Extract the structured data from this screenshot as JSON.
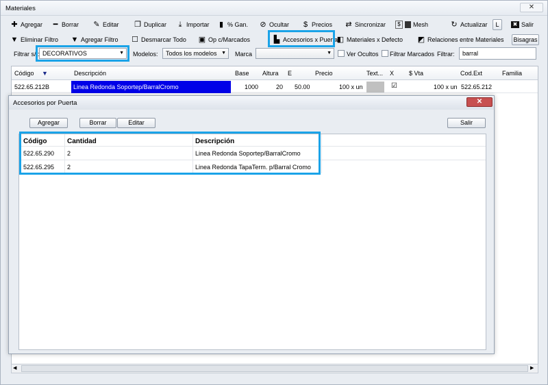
{
  "window": {
    "title": "Materiales",
    "close_label": "✕"
  },
  "toolbar": {
    "row1": [
      {
        "icon": "plus-icon",
        "glyph": "✚",
        "label": "Agregar"
      },
      {
        "icon": "minus-icon",
        "glyph": "━",
        "label": "Borrar"
      },
      {
        "icon": "edit-icon",
        "glyph": "✎",
        "label": "Editar"
      },
      {
        "icon": "duplicate-icon",
        "glyph": "❐",
        "label": "Duplicar"
      },
      {
        "icon": "import-icon",
        "glyph": "⤓",
        "label": "Importar"
      },
      {
        "icon": "bar-chart-icon",
        "glyph": "▮",
        "label": "% Gan."
      },
      {
        "icon": "hide-icon",
        "glyph": "⊘",
        "label": "Ocultar"
      },
      {
        "icon": "dollar-icon",
        "glyph": "$",
        "label": "Precios"
      },
      {
        "icon": "sync-icon",
        "glyph": "⇄",
        "label": "Sincronizar"
      },
      {
        "icon": "mesh-icon",
        "glyph": "$",
        "label": "Mesh"
      },
      {
        "icon": "refresh-icon",
        "glyph": "↻",
        "label": "Actualizar"
      },
      {
        "icon": "l-icon",
        "glyph": "L",
        "label": ""
      },
      {
        "icon": "exit-icon",
        "glyph": "✖",
        "label": "Salir"
      }
    ],
    "row2": [
      {
        "icon": "filter-remove-icon",
        "glyph": "▼",
        "label": "Eliminar Filtro"
      },
      {
        "icon": "filter-add-icon",
        "glyph": "▼",
        "label": "Agregar Filtro"
      },
      {
        "icon": "uncheck-icon",
        "glyph": "☐",
        "label": "Desmarcar Todo"
      },
      {
        "icon": "op-icon",
        "glyph": "▣",
        "label": "Op c/Marcados"
      },
      {
        "icon": "accessories-icon",
        "glyph": "▙",
        "label": "Accesorios x Puerta"
      },
      {
        "icon": "materials-icon",
        "glyph": "◧",
        "label": "Materiales x Defecto"
      },
      {
        "icon": "relations-icon",
        "glyph": "◩",
        "label": "Relaciones entre Materiales"
      },
      {
        "icon": "",
        "glyph": "",
        "label": "Bisagras"
      }
    ]
  },
  "filters": {
    "filtrar_label": "Filtrar s/ :",
    "filtrar_value": "DECORATIVOS",
    "modelos_label": "Modelos:",
    "modelos_value": "Todos los modelos",
    "marca_label": "Marca",
    "marca_value": "",
    "ver_ocultos": "Ver Ocultos",
    "filtrar_marcados": "Filtrar Marcados",
    "filtrar_text_label": "Filtrar:",
    "filtrar_text_value": "barral"
  },
  "grid": {
    "columns": [
      "Código",
      "Descripción",
      "Base",
      "Altura",
      "E",
      "Precio",
      "Text...",
      "X",
      "$ Vta",
      "Cod.Ext",
      "Familia"
    ],
    "sort_glyph": "▼",
    "rows": [
      {
        "codigo": "522.65.212B",
        "descripcion": "Linea Redonda Soportep/BarralCromo",
        "base": "1000",
        "altura": "20",
        "e": "50.00",
        "precio": "100 x un",
        "x": "☑",
        "vta": "100 x un",
        "cod_ext": "522.65.212"
      }
    ]
  },
  "dialog": {
    "title": "Accesorios por Puerta",
    "close_label": "✕",
    "buttons": {
      "agregar": "Agregar",
      "borrar": "Borrar",
      "editar": "Editar",
      "salir": "Salir"
    },
    "columns": [
      "Código",
      "Cantidad",
      "Descripción"
    ],
    "rows": [
      {
        "codigo": "522.65.290",
        "cantidad": "2",
        "descripcion": "Linea Redonda Soportep/BarralCromo"
      },
      {
        "codigo": "522.65.295",
        "cantidad": "2",
        "descripcion": "Linea Redonda TapaTerm. p/Barral Cromo"
      }
    ]
  },
  "colors": {
    "highlight": "#1aa3e8",
    "selection": "#0000e8"
  }
}
